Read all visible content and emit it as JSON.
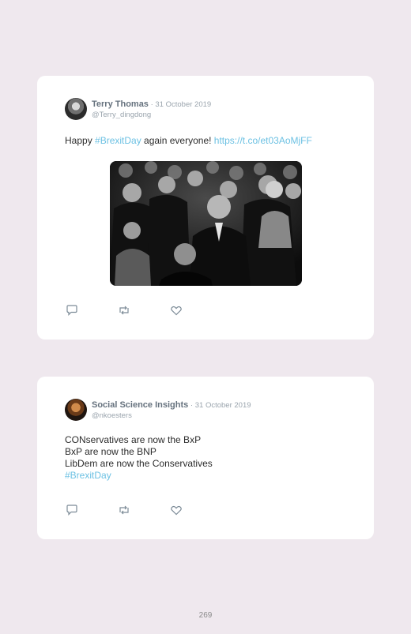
{
  "tweets": [
    {
      "name": "Terry Thomas",
      "separator": " · ",
      "date": "31 October 2019",
      "handle": "@Terry_dingdong",
      "text_pre": "Happy ",
      "hashtag": "#BrexitDay",
      "text_mid": " again everyone! ",
      "link": "https://t.co/et03AoMjFF",
      "media": "crowd-of-people-in-formal-wear-image",
      "icons": [
        "reply-icon",
        "retweet-icon",
        "like-icon"
      ]
    },
    {
      "name": "Social Science Insights",
      "separator": " · ",
      "date": "31 October 2019",
      "handle": "@nkoesters",
      "lines": [
        "CONservatives are now the BxP",
        "BxP are now the BNP",
        "LibDem are now the Conservatives"
      ],
      "hashtag": "#BrexitDay",
      "icons": [
        "reply-icon",
        "retweet-icon",
        "like-icon"
      ]
    }
  ],
  "page_number": "269",
  "colors": {
    "background": "#efe8ee",
    "link": "#6cc1e3",
    "name": "#66727e",
    "muted": "#9aa4ad"
  }
}
